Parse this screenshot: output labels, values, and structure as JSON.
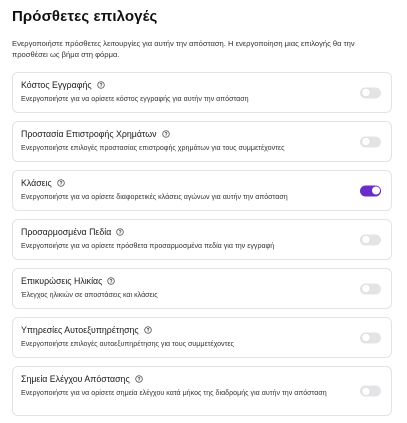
{
  "header": {
    "title": "Πρόσθετες επιλογές",
    "description": "Ενεργοποιήστε πρόσθετες λειτουργίες για αυτήν την απόσταση. Η ενεργοποίηση μιας επιλογής θα την προσθέσει ως βήμα στη φόρμα."
  },
  "colors": {
    "toggle_on": "#6b2cc9",
    "toggle_off": "#e4e4e7"
  },
  "options": [
    {
      "title": "Κόστος Εγγραφής",
      "description": "Ενεργοποιήστε για να ορίσετε κόστος εγγραφής για αυτήν την απόσταση",
      "enabled": false,
      "icon": "info-icon"
    },
    {
      "title": "Προστασία Επιστροφής Χρημάτων",
      "description": "Ενεργοποιήστε επιλογές προστασίας επιστροφής χρημάτων για τους συμμετέχοντες",
      "enabled": false,
      "icon": "info-icon"
    },
    {
      "title": "Κλάσεις",
      "description": "Ενεργοποιήστε για να ορίσετε διαφορετικές κλάσεις αγώνων για αυτήν την απόσταση",
      "enabled": true,
      "icon": "info-icon"
    },
    {
      "title": "Προσαρμοσμένα Πεδία",
      "description": "Ενεργοποιήστε για να ορίσετε πρόσθετα προσαρμοσμένα πεδία για την εγγραφή",
      "enabled": false,
      "icon": "info-icon"
    },
    {
      "title": "Επικυρώσεις Ηλικίας",
      "description": "Έλεγχος ηλικιών σε αποστάσεις και κλάσεις",
      "enabled": false,
      "icon": "info-icon"
    },
    {
      "title": "Υπηρεσίες Αυτοεξυπηρέτησης",
      "description": "Ενεργοποιήστε επιλογές αυτοεξυπηρέτησης για τους συμμετέχοντες",
      "enabled": false,
      "icon": "info-icon"
    },
    {
      "title": "Σημεία Ελέγχου Απόστασης",
      "description": "Ενεργοποιήστε για να ορίσετε σημεία ελέγχου κατά μήκος της διαδρομής για αυτήν την απόσταση",
      "enabled": false,
      "icon": "info-icon"
    }
  ]
}
